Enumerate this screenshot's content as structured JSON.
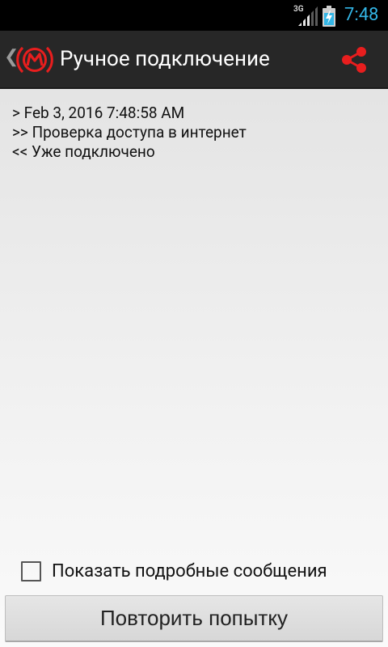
{
  "status_bar": {
    "network": "3G",
    "time": "7:48",
    "time_color": "#33b5e5"
  },
  "action_bar": {
    "title": "Ручное подключение",
    "up_icon": "chevron-left-icon",
    "logo_icon": "metro-wifi-logo-icon",
    "share_icon": "share-icon",
    "accent_color": "#e81e1e"
  },
  "log": {
    "lines": [
      "> Feb 3, 2016 7:48:58 AM",
      ">> Проверка доступа в интернет",
      "<< Уже подключено"
    ]
  },
  "options": {
    "verbose_label": "Показать подробные сообщения",
    "verbose_checked": false
  },
  "retry_button": {
    "label": "Повторить попытку"
  }
}
